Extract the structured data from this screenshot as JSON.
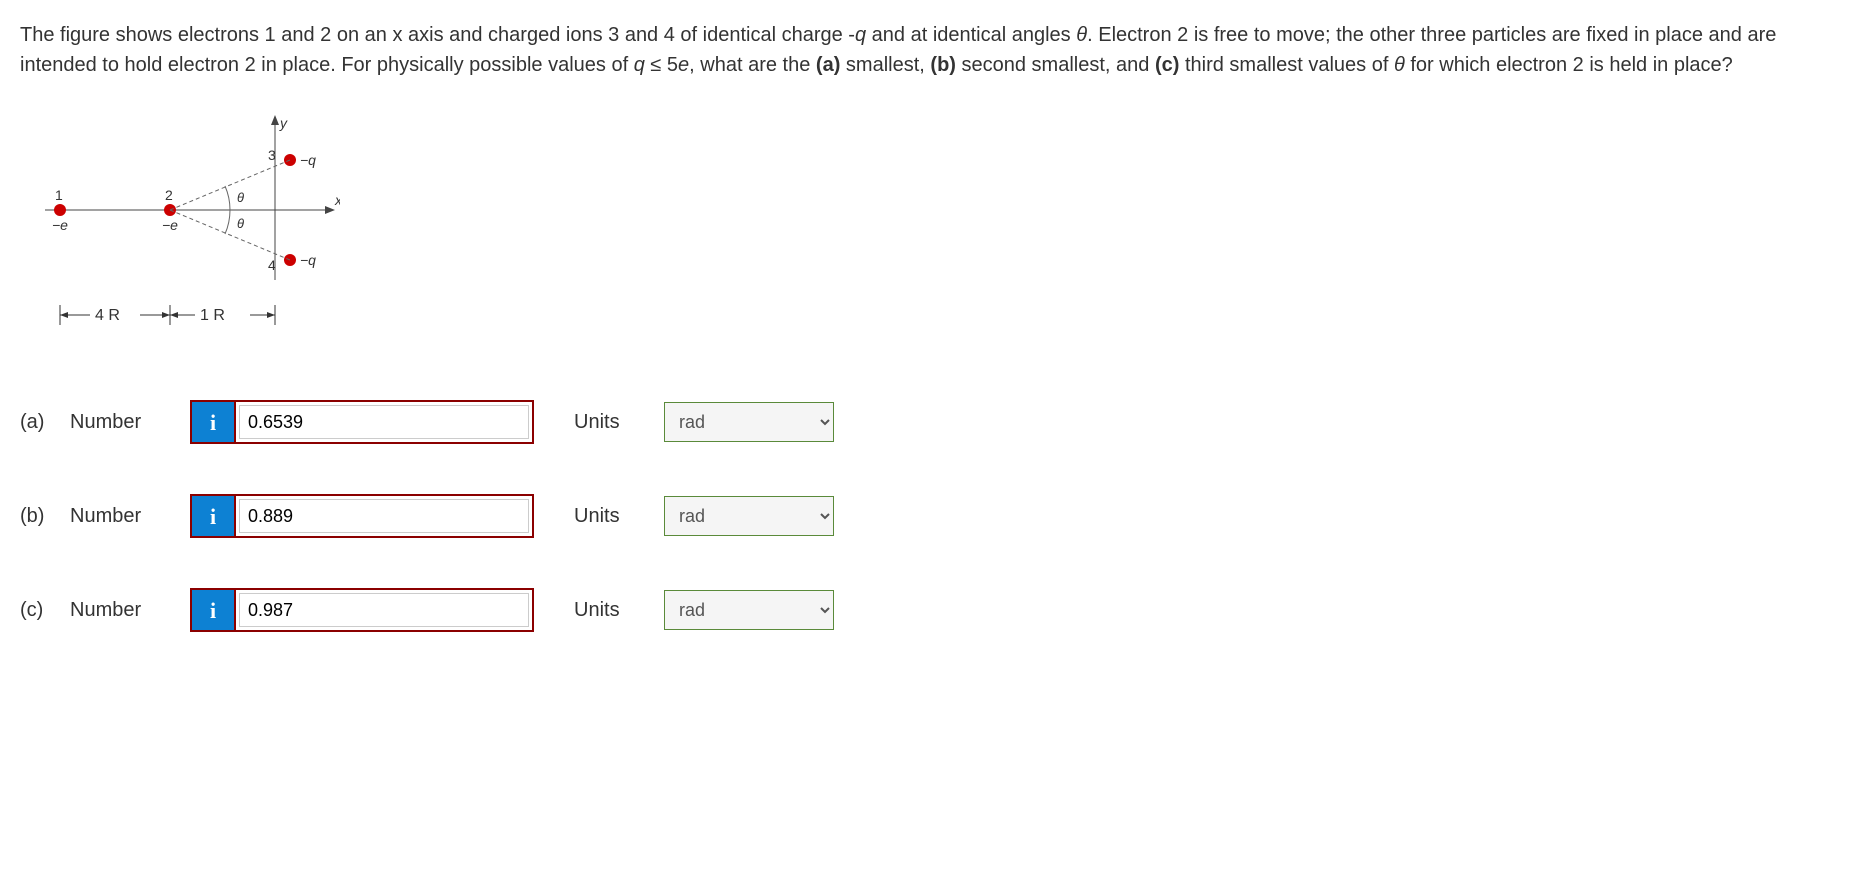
{
  "question": {
    "prefix": "The figure shows electrons 1 and 2 on an x axis and charged ions 3 and 4 of identical charge -",
    "q1": "q",
    "mid1": " and at identical angles ",
    "theta1": "θ",
    "mid2": ". Electron 2 is free to move; the other three particles are fixed in place and are intended to hold electron 2 in place. For physically possible values of ",
    "q2": "q",
    "le": " ≤ 5",
    "e": "e",
    "comma": ", what are the ",
    "part_a_label": "(a)",
    "a_text": " smallest, ",
    "part_b_label": "(b)",
    "b_text": " second smallest, and ",
    "part_c_label": "(c)",
    "c_text": " third smallest values of ",
    "theta2": "θ",
    "suffix": " for which electron 2 is held in place?"
  },
  "figure": {
    "y_label": "y",
    "x_label": "x",
    "label_1": "1",
    "label_2": "2",
    "label_3": "3",
    "label_4": "4",
    "neg_e1": "−e",
    "neg_e2": "−e",
    "neg_q1": "−q",
    "neg_q2": "−q",
    "theta1": "θ",
    "theta2": "θ",
    "dist_4r": "4 R",
    "dist_1r": "1 R"
  },
  "answers": {
    "a": {
      "part": "(a)",
      "number_label": "Number",
      "info": "i",
      "value": "0.6539",
      "units_label": "Units",
      "units_value": "rad"
    },
    "b": {
      "part": "(b)",
      "number_label": "Number",
      "info": "i",
      "value": "0.889",
      "units_label": "Units",
      "units_value": "rad"
    },
    "c": {
      "part": "(c)",
      "number_label": "Number",
      "info": "i",
      "value": "0.987",
      "units_label": "Units",
      "units_value": "rad"
    }
  }
}
